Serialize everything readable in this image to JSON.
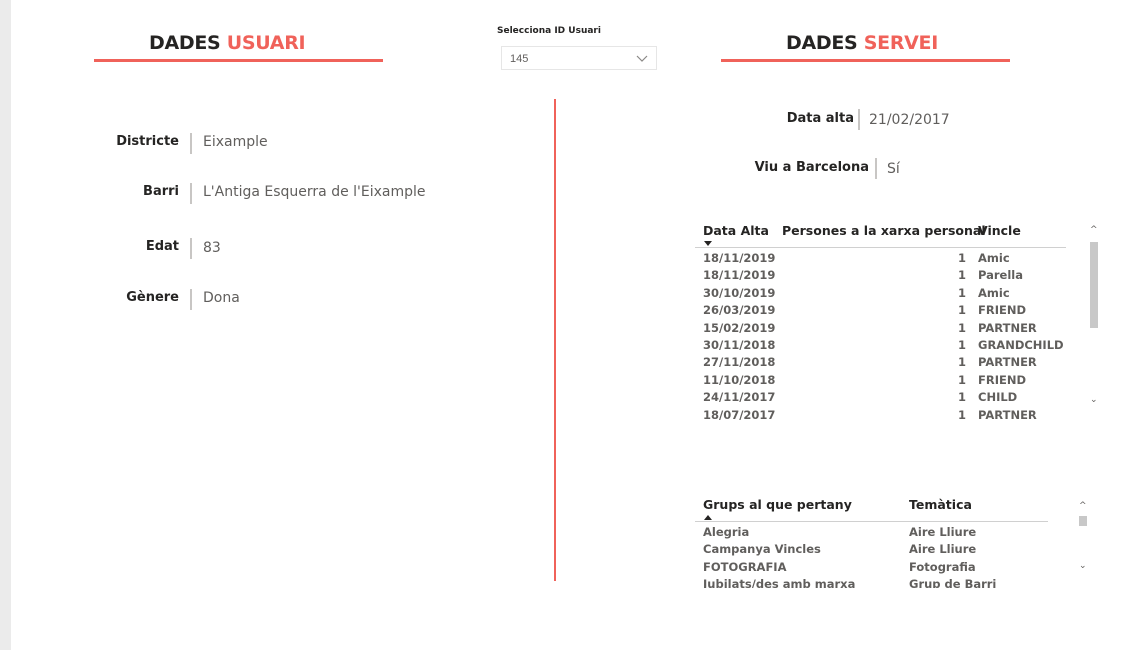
{
  "user_section": {
    "title_dark": "DADES",
    "title_accent": "USUARI",
    "fields": [
      {
        "label": "Districte",
        "value": "Eixample"
      },
      {
        "label": "Barri",
        "value": "L'Antiga Esquerra de l'Eixample"
      },
      {
        "label": "Edat",
        "value": "83"
      },
      {
        "label": "Gènere",
        "value": "Dona"
      }
    ]
  },
  "slicer": {
    "label": "Selecciona ID Usuari",
    "selected": "145",
    "icon": "chevron-down-icon"
  },
  "service_section": {
    "title_dark": "DADES",
    "title_accent": "SERVEI",
    "fields": [
      {
        "label": "Data alta",
        "value": "21/02/2017"
      },
      {
        "label": "Viu a Barcelona",
        "value": "Sí"
      }
    ]
  },
  "network_table": {
    "columns": [
      "Data Alta",
      "Persones a la xarxa personal",
      "Vincle"
    ],
    "rows": [
      [
        "18/11/2019",
        "1",
        "Amic"
      ],
      [
        "18/11/2019",
        "1",
        "Parella"
      ],
      [
        "30/10/2019",
        "1",
        "Amic"
      ],
      [
        "26/03/2019",
        "1",
        "FRIEND"
      ],
      [
        "15/02/2019",
        "1",
        "PARTNER"
      ],
      [
        "30/11/2018",
        "1",
        "GRANDCHILD"
      ],
      [
        "27/11/2018",
        "1",
        "PARTNER"
      ],
      [
        "11/10/2018",
        "1",
        "FRIEND"
      ],
      [
        "24/11/2017",
        "1",
        "CHILD"
      ],
      [
        "18/07/2017",
        "1",
        "PARTNER"
      ]
    ]
  },
  "groups_table": {
    "columns": [
      "Grups al que pertany",
      "Temàtica"
    ],
    "rows": [
      [
        "Alegria",
        "Aire Lliure"
      ],
      [
        "Campanya Vincles",
        "Aire Lliure"
      ],
      [
        "FOTOGRAFIA",
        "Fotografia"
      ],
      [
        "Jubilats/des amb marxa",
        "Grup de Barri"
      ]
    ]
  },
  "colors": {
    "accent": "#f0625a",
    "text_dark": "#252423",
    "text_muted": "#605e5c"
  }
}
